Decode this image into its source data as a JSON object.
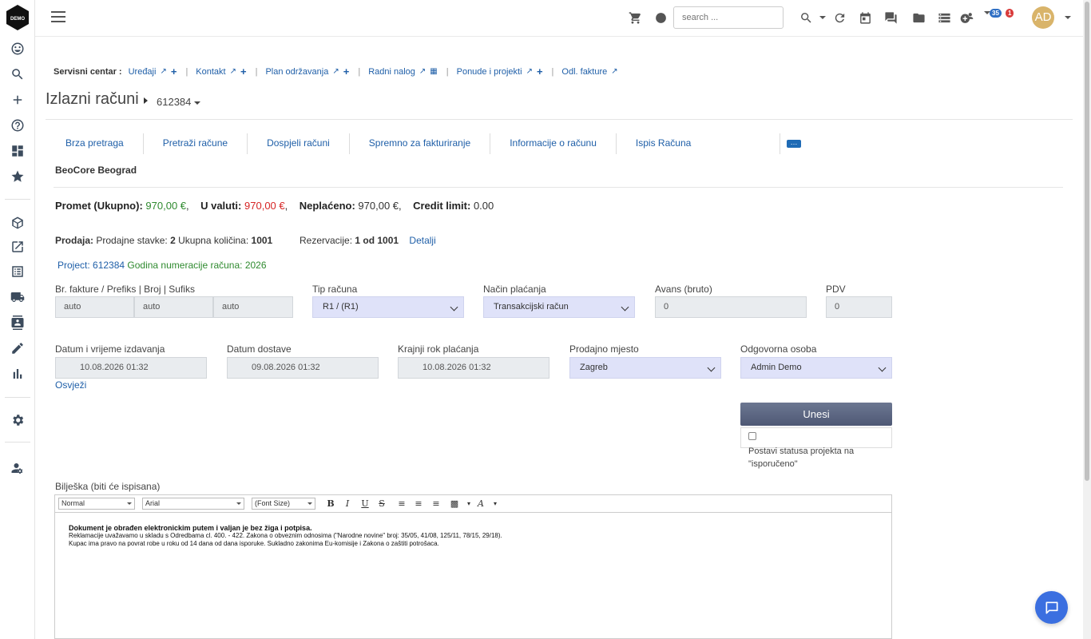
{
  "colors": {
    "link": "#1f5fa8",
    "green": "#2f8a2f",
    "red": "#d62525",
    "select_bg": "#dfe2f9",
    "button": "#4e5875",
    "chat": "#3b6fe0"
  },
  "logo_text": "DEMO",
  "topbar": {
    "search_placeholder": "search ...",
    "badge_blue": "35",
    "badge_red": "1",
    "avatar": "AD"
  },
  "service_center": {
    "label": "Servisni centar :",
    "links": [
      {
        "label": "Uređaji"
      },
      {
        "label": "Kontakt"
      },
      {
        "label": "Plan održavanja"
      },
      {
        "label": "Radni nalog"
      },
      {
        "label": "Ponude i projekti"
      },
      {
        "label": "Odl. fakture"
      }
    ]
  },
  "page": {
    "title": "Izlazni računi",
    "breadcrumb_value": "612384"
  },
  "tabs": [
    "Brza pretraga",
    "Pretraži račune",
    "Dospjeli računi",
    "Spremno za fakturiranje",
    "Informacije o računu",
    "Ispis Računa"
  ],
  "company": "BeoCore Beograd",
  "totals": {
    "promet_label": "Promet (Ukupno):",
    "promet_value": "970,00 €",
    "valuta_label": "U valuti:",
    "valuta_value": "970,00 €",
    "neplaceno_label": "Neplaćeno:",
    "neplaceno_value": "970,00 €",
    "credit_label": "Credit limit:",
    "credit_value": "0.00"
  },
  "sales": {
    "label": "Prodaja:",
    "stavke_label": "Prodajne stavke:",
    "stavke_value": "2",
    "kolicina_label": "Ukupna količina:",
    "kolicina_value": "1001",
    "rezervacije_label": "Rezervacije:",
    "rezervacije_value": "1 od 1001",
    "detalji": "Detalji"
  },
  "project": {
    "label": "Project: 612384",
    "year_text": "Godina numeracije računa: 2026"
  },
  "form": {
    "broj_label": "Br. fakture / Prefiks | Broj | Sufiks",
    "prefiks": "auto",
    "broj": "auto",
    "sufiks": "auto",
    "tip_label": "Tip računa",
    "tip_value": "R1 / (R1)",
    "nacin_label": "Način plaćanja",
    "nacin_value": "Transakcijski račun",
    "avans_label": "Avans (bruto)",
    "avans_value": "0",
    "pdv_label": "PDV",
    "pdv_value": "0",
    "datum_label": "Datum i vrijeme izdavanja",
    "datum_value": "10.08.2026 01:32",
    "dostava_label": "Datum dostave",
    "dostava_value": "09.08.2026 01:32",
    "rok_label": "Krajnji rok plaćanja",
    "rok_value": "10.08.2026 01:32",
    "mjesto_label": "Prodajno mjesto",
    "mjesto_value": "Zagreb",
    "osoba_label": "Odgovorna osoba",
    "osoba_value": "Admin Demo",
    "refresh": "Osvježi",
    "submit": "Unesi",
    "checkbox_label": "Postavi statusa projekta na \"isporučeno\""
  },
  "note": {
    "label": "Bilješka (biti će ispisana)",
    "toolbar": {
      "format": "Normal",
      "font": "Arial",
      "size": "(Font Size)",
      "bold": "B",
      "italic": "I",
      "underline": "U",
      "strike": "S"
    },
    "line1": "Dokument je obrađen elektronickim putem i valjan je bez žiga i potpisa.",
    "line2": "Reklamacije uvažavamo u skladu s Odredbama cl. 400. - 422. Zakona o obveznim odnosima (\"Narodne novine\" broj: 35/05, 41/08, 125/11, 78/15, 29/18).",
    "line3": "Kupac ima pravo na povrat robe u roku od 14 dana od dana isporuke. Sukladno zakonima Eu-komisije i Zakona o zaštiti potrošaca."
  }
}
